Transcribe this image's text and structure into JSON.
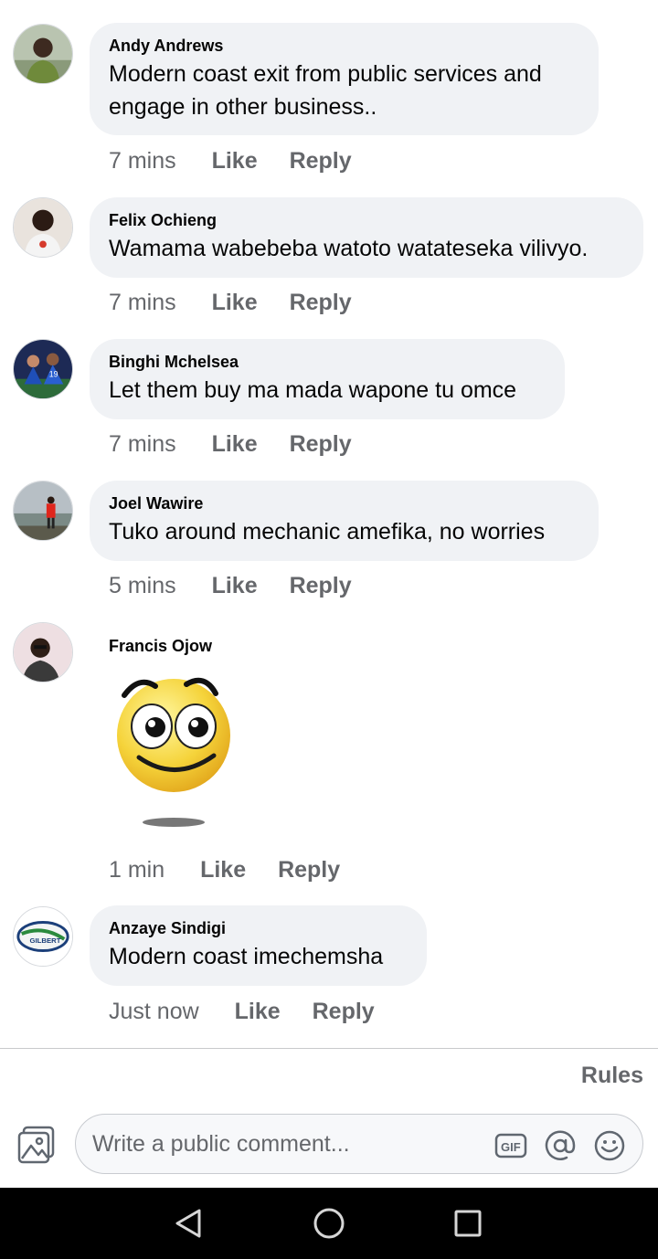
{
  "comments": [
    {
      "author": "Andy Andrews",
      "text": "Modern coast exit from public services and engage in other business..",
      "time": "7 mins",
      "like": "Like",
      "reply": "Reply"
    },
    {
      "author": "Felix Ochieng",
      "text": "Wamama wabebeba watoto watateseka vilivyo.",
      "time": "7 mins",
      "like": "Like",
      "reply": "Reply"
    },
    {
      "author": "Binghi Mchelsea",
      "text": "Let them buy ma mada wapone tu omce",
      "time": "7 mins",
      "like": "Like",
      "reply": "Reply"
    },
    {
      "author": "Joel Wawire",
      "text": "Tuko around mechanic amefika, no worries",
      "time": "5 mins",
      "like": "Like",
      "reply": "Reply"
    },
    {
      "author": "Francis Ojow",
      "sticker": "smiling-emoji-sticker",
      "time": "1 min",
      "like": "Like",
      "reply": "Reply"
    },
    {
      "author": "Anzaye Sindigi",
      "text": "Modern coast imechemsha",
      "time": "Just now",
      "like": "Like",
      "reply": "Reply",
      "avatar_text": "GILBERT"
    }
  ],
  "footer": {
    "rules": "Rules",
    "comment_placeholder": "Write a public comment...",
    "icons": [
      "photo-icon",
      "gif-icon",
      "mention-icon",
      "emoji-icon"
    ]
  },
  "system_nav": {
    "icons": [
      "back-icon",
      "home-icon",
      "recents-icon"
    ]
  },
  "colors": {
    "bubble": "#f0f2f5",
    "secondary_text": "#65676b",
    "nav_bar": "#000000"
  }
}
